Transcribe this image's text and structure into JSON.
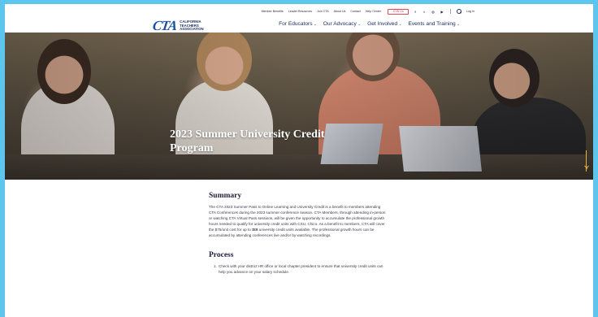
{
  "utility_nav": {
    "links": [
      "Member Benefits",
      "Leader Resources",
      "Join CTA",
      "About Us",
      "Contact",
      "Help Center"
    ],
    "join_button": "JOIN Us",
    "social_icons": [
      "facebook-icon",
      "twitter-icon",
      "instagram-icon",
      "youtube-icon"
    ],
    "language": "Log In"
  },
  "brand": {
    "logo_mark": "CTA",
    "logo_name_line1": "California",
    "logo_name_line2": "Teachers",
    "logo_name_line3": "Association"
  },
  "main_nav": {
    "items": [
      {
        "label": "For Educators"
      },
      {
        "label": "Our Advocacy"
      },
      {
        "label": "Get Involved"
      },
      {
        "label": "Events and Training"
      }
    ]
  },
  "hero": {
    "title": "2023 Summer University Credit Program",
    "accent_color": "#e6b43a"
  },
  "summary": {
    "heading": "Summary",
    "body_before": "The CTA 2023 Summer Pass to Online Learning and University Credit is a benefit to members attending CTA Conferences during the 2023 summer conference season. CTA Members, through attending in-person or watching CTA Virtual Pass sessions, will be given the opportunity to accumulate the professional growth hours needed to qualify for university credit units with CSU, Chico. As a benefit to members, CTA will cover the $75/unit cost for up to ",
    "body_bold": "SIX",
    "body_after": " university credit units available. The professional growth hours can be accumulated by attending conferences live and/or by watching recordings."
  },
  "process": {
    "heading": "Process",
    "steps": [
      {
        "num": "1.",
        "text": "Check with your district HR office or local chapter president to ensure that university credit units can help you advance on your salary schedule."
      }
    ]
  },
  "colors": {
    "page_bg": "#5cc6ec",
    "navy": "#1b2f66",
    "brand_blue": "#1a4fa3",
    "join_red": "#e24a58"
  }
}
